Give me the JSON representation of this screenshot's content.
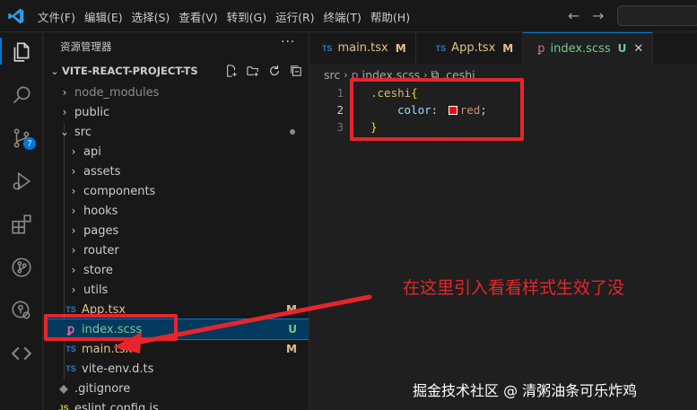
{
  "menu": [
    "文件(F)",
    "编辑(E)",
    "选择(S)",
    "查看(V)",
    "转到(G)",
    "运行(R)",
    "终端(T)",
    "帮助(H)"
  ],
  "activity_bar": {
    "items": [
      "explorer-icon",
      "search-icon",
      "source-control-icon",
      "run-debug-icon",
      "extensions-icon",
      "git-graph-icon",
      "remote-explorer-icon",
      "code-icon"
    ],
    "source_control_badge": "7"
  },
  "sidebar": {
    "title": "资源管理器",
    "more": "···",
    "project_name": "VITE-REACT-PROJECT-TS",
    "tree": [
      {
        "label": "node_modules",
        "type": "folder",
        "depth": 0,
        "dim": true
      },
      {
        "label": "public",
        "type": "folder",
        "depth": 0
      },
      {
        "label": "src",
        "type": "folder-open",
        "depth": 0,
        "status": "modified-dot"
      },
      {
        "label": "api",
        "type": "folder",
        "depth": 1
      },
      {
        "label": "assets",
        "type": "folder",
        "depth": 1
      },
      {
        "label": "components",
        "type": "folder",
        "depth": 1
      },
      {
        "label": "hooks",
        "type": "folder",
        "depth": 1
      },
      {
        "label": "pages",
        "type": "folder",
        "depth": 1
      },
      {
        "label": "router",
        "type": "folder",
        "depth": 1
      },
      {
        "label": "store",
        "type": "folder",
        "depth": 1
      },
      {
        "label": "utils",
        "type": "folder",
        "depth": 1
      },
      {
        "label": "App.tsx",
        "type": "ts",
        "depth": 1,
        "git": "M"
      },
      {
        "label": "index.scss",
        "type": "scss",
        "depth": 1,
        "git": "U",
        "selected": true
      },
      {
        "label": "main.tsx",
        "type": "ts",
        "depth": 1,
        "git": "M"
      },
      {
        "label": "vite-env.d.ts",
        "type": "ts",
        "depth": 1
      },
      {
        "label": ".gitignore",
        "type": "git",
        "depth": 0
      },
      {
        "label": "eslint.config.js",
        "type": "js",
        "depth": 0
      }
    ]
  },
  "tabs": [
    {
      "label": "main.tsx",
      "icon": "TS",
      "status": "M"
    },
    {
      "label": "App.tsx",
      "icon": "TS",
      "status": "M"
    },
    {
      "label": "index.scss",
      "icon": "scss",
      "status": "U",
      "active": true
    }
  ],
  "breadcrumb": [
    "src",
    "index.scss",
    ".ceshi"
  ],
  "code": {
    "line_numbers": [
      "1",
      "2",
      "3"
    ],
    "selector": ".ceshi",
    "open_brace": "{",
    "property": "color",
    "colon": ":",
    "value": "red",
    "semicolon": ";",
    "close_brace": "}",
    "swatch_color": "#ff0000"
  },
  "annotation": "在这里引入看看样式生效了没",
  "watermark": "掘金技术社区 @ 清粥油条可乐炸鸡",
  "colors": {
    "annotation_red": "#e5262b",
    "accent": "#0078d4"
  }
}
